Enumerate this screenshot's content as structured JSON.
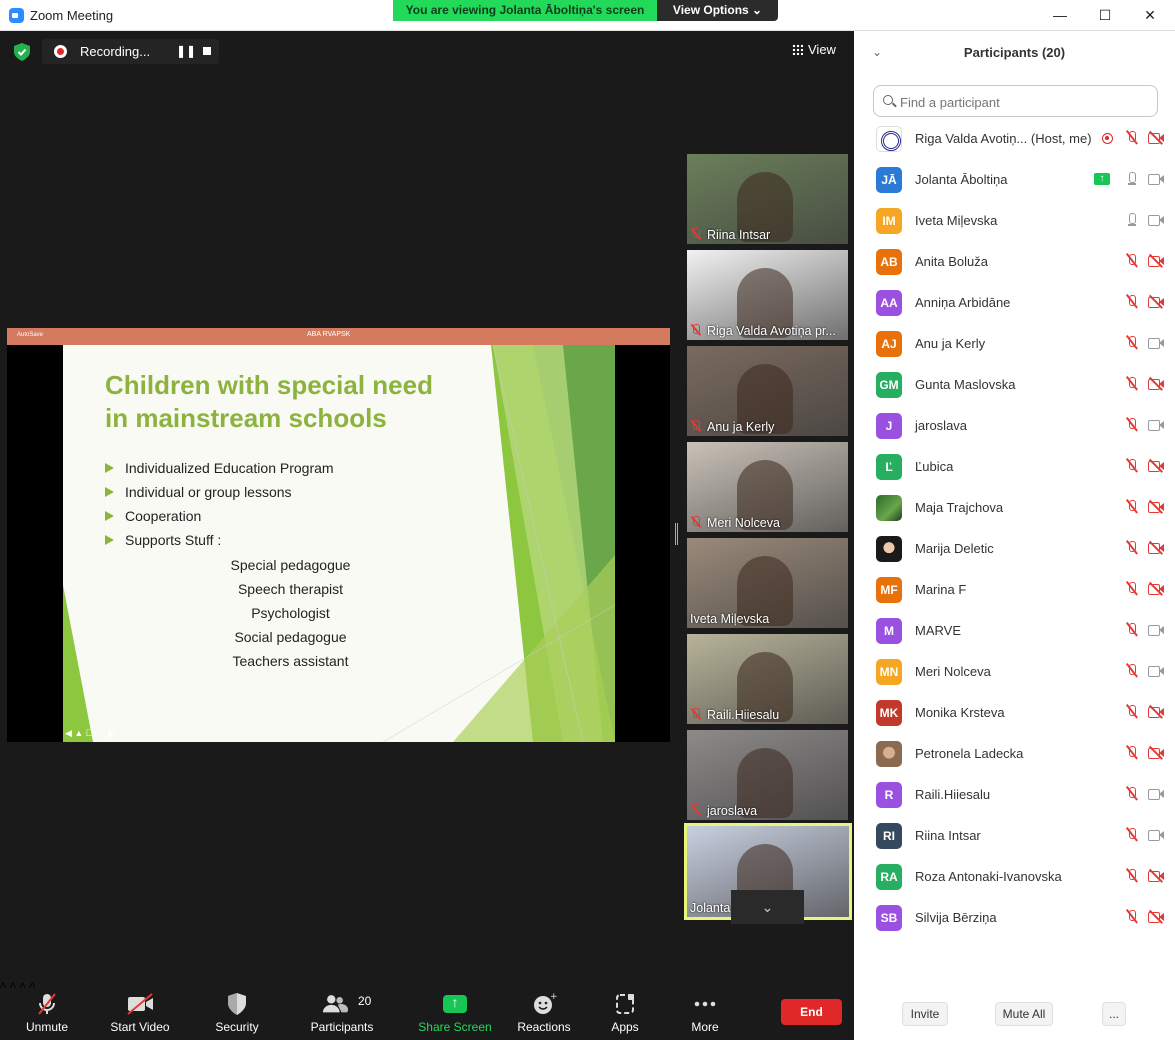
{
  "window": {
    "title": "Zoom Meeting",
    "min": "—",
    "max": "☐",
    "close": "✕"
  },
  "banner": {
    "viewing": "You are viewing Jolanta Āboltiņa's screen",
    "view_options": "View Options ⌄"
  },
  "recording": {
    "label": "Recording...",
    "pause": "❚❚"
  },
  "view_button": {
    "label": "View"
  },
  "shared_screen": {
    "doc_title": "ABA RVAPSK",
    "autosave": "AutoSave",
    "slide": {
      "title_line1": "Children with special need",
      "title_line2": "in mainstream schools",
      "bullets": [
        "Individualized Education Program",
        "Individual or group lessons",
        "Cooperation",
        "Supports Stuff :"
      ],
      "sub_items": [
        "Special pedagogue",
        "Speech therapist",
        "Psychologist",
        "Social pedagogue",
        "Teachers assistant"
      ],
      "nav": "◀ ▲ ☐ ⋯ ▶"
    }
  },
  "video_tiles": [
    {
      "name": "Riina Intsar",
      "muted": true,
      "bg": "#6b7f5a"
    },
    {
      "name": "Riga Valda Avotiņa pr...",
      "muted": true,
      "bg": "#f2f2f2"
    },
    {
      "name": "Anu ja Kerly",
      "muted": true,
      "bg": "#7a6a5e"
    },
    {
      "name": "Meri Nolceva",
      "muted": true,
      "bg": "#c9c2b8"
    },
    {
      "name": "Iveta Miļevska",
      "muted": false,
      "bg": "#9a8a7a"
    },
    {
      "name": "Raili.Hiiesalu",
      "muted": true,
      "bg": "#b8b49a"
    },
    {
      "name": "jaroslava",
      "muted": true,
      "bg": "#8e8a8a"
    },
    {
      "name": "Jolanta Āboltiņa",
      "muted": false,
      "bg": "#c8d0e0"
    }
  ],
  "strip_down": "⌄",
  "toolbar": {
    "unmute": "Unmute",
    "start_video": "Start Video",
    "security": "Security",
    "participants": "Participants",
    "participants_count": "20",
    "share_screen": "Share Screen",
    "reactions": "Reactions",
    "apps": "Apps",
    "more": "More",
    "end": "End",
    "caret": "^"
  },
  "panel": {
    "collapse": "⌄",
    "title": "Participants (20)",
    "search_placeholder": "Find a participant",
    "participants": [
      {
        "initials": "",
        "name": "Riga Valda Avotiņ... (Host, me)",
        "color": "#ffffff",
        "mic": "muted",
        "cam": "off",
        "badge": "rec"
      },
      {
        "initials": "JĀ",
        "name": "Jolanta Āboltiņa",
        "color": "#2b7bd6",
        "mic": "on",
        "cam": "on",
        "badge": "share"
      },
      {
        "initials": "IM",
        "name": "Iveta Miļevska",
        "color": "#f5a623",
        "mic": "on",
        "cam": "on",
        "badge": ""
      },
      {
        "initials": "AB",
        "name": "Anita Boluža",
        "color": "#e8710a",
        "mic": "muted",
        "cam": "off",
        "badge": ""
      },
      {
        "initials": "AA",
        "name": "Anniņa Arbidāne",
        "color": "#9b51e0",
        "mic": "muted",
        "cam": "off",
        "badge": ""
      },
      {
        "initials": "AJ",
        "name": "Anu ja Kerly",
        "color": "#e8710a",
        "mic": "muted",
        "cam": "on",
        "badge": ""
      },
      {
        "initials": "GM",
        "name": "Gunta Maslovska",
        "color": "#27ae60",
        "mic": "muted",
        "cam": "off",
        "badge": ""
      },
      {
        "initials": "J",
        "name": "jaroslava",
        "color": "#9b51e0",
        "mic": "muted",
        "cam": "on",
        "badge": ""
      },
      {
        "initials": "Ľ",
        "name": "Ľubica",
        "color": "#27ae60",
        "mic": "muted",
        "cam": "off",
        "badge": ""
      },
      {
        "initials": "",
        "name": "Maja Trajchova",
        "color": "#2d6a2d",
        "mic": "muted",
        "cam": "off",
        "badge": "",
        "photo": "img-photo4"
      },
      {
        "initials": "",
        "name": "Marija Deletic",
        "color": "#1a1a1a",
        "mic": "muted",
        "cam": "off",
        "badge": "",
        "photo": "img-photo2"
      },
      {
        "initials": "MF",
        "name": "Marina F",
        "color": "#e8710a",
        "mic": "muted",
        "cam": "off",
        "badge": ""
      },
      {
        "initials": "M",
        "name": "MARVE",
        "color": "#9b51e0",
        "mic": "muted",
        "cam": "on",
        "badge": ""
      },
      {
        "initials": "MN",
        "name": "Meri Nolceva",
        "color": "#f5a623",
        "mic": "muted",
        "cam": "on",
        "badge": ""
      },
      {
        "initials": "MK",
        "name": "Monika Krsteva",
        "color": "#c0392b",
        "mic": "muted",
        "cam": "off",
        "badge": ""
      },
      {
        "initials": "",
        "name": "Petronela Ladecka",
        "color": "#8a6a50",
        "mic": "muted",
        "cam": "off",
        "badge": "",
        "photo": "img-photo3"
      },
      {
        "initials": "R",
        "name": "Raili.Hiiesalu",
        "color": "#9b51e0",
        "mic": "muted",
        "cam": "on",
        "badge": ""
      },
      {
        "initials": "RI",
        "name": "Riina Intsar",
        "color": "#34495e",
        "mic": "muted",
        "cam": "on",
        "badge": ""
      },
      {
        "initials": "RA",
        "name": "Roza Antonaki-Ivanovska",
        "color": "#27ae60",
        "mic": "muted",
        "cam": "off",
        "badge": ""
      },
      {
        "initials": "SB",
        "name": "Silvija Bērziņa",
        "color": "#9b51e0",
        "mic": "muted",
        "cam": "off",
        "badge": ""
      }
    ],
    "invite": "Invite",
    "mute_all": "Mute All",
    "more": "..."
  }
}
